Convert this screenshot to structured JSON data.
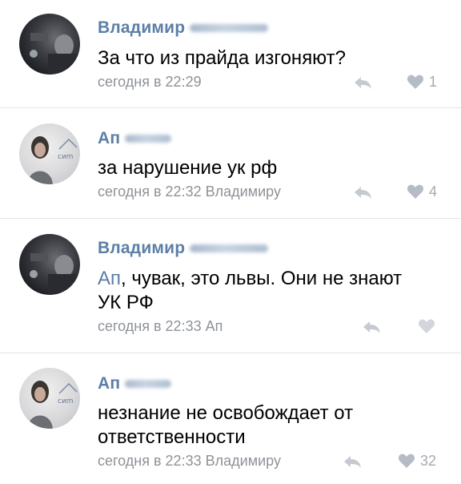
{
  "comments": [
    {
      "author": "Владимир",
      "text": "За что из прайда изгоняют?",
      "time": "сегодня в 22:29",
      "reply_to": "",
      "likes": "1",
      "avatar": "dark-photo"
    },
    {
      "author": "Ап",
      "text": "за нарушение ук рф",
      "time": "сегодня в 22:32",
      "reply_to": "Владимиру",
      "likes": "4",
      "avatar": "light-photo"
    },
    {
      "author": "Владимир",
      "mention": "Ап",
      "text": ", чувак, это львы. Они не знают",
      "text2": "УК РФ",
      "time": "сегодня в 22:33",
      "reply_to": "Ап",
      "likes": "",
      "avatar": "dark-photo"
    },
    {
      "author": "Ап",
      "text": "незнание не освобождает от",
      "text2": "ответственности",
      "time": "сегодня в 22:33",
      "reply_to": "Владимиру",
      "likes": "32",
      "avatar": "light-photo"
    }
  ],
  "icons": {
    "reply": "reply-arrow-icon",
    "like": "heart-icon"
  },
  "colors": {
    "accent": "#5b7fa6",
    "meta": "#8e9298",
    "divider": "#e2e4e8"
  }
}
